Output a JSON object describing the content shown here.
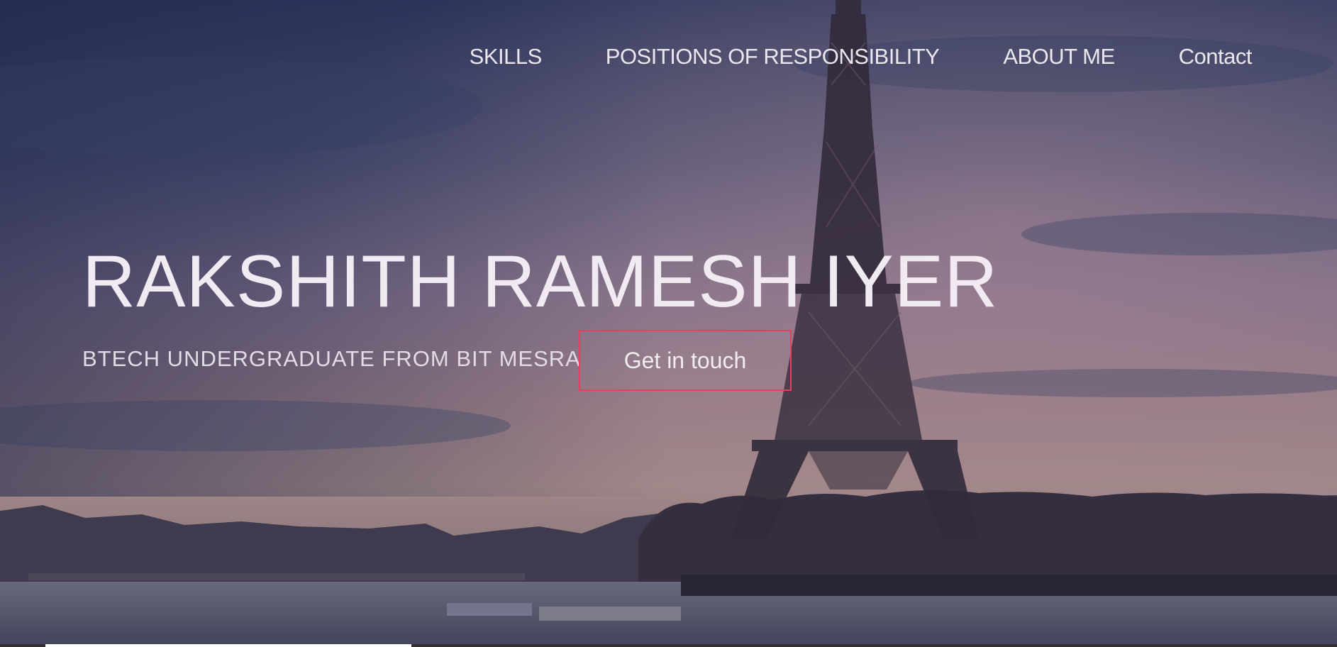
{
  "nav": {
    "items": [
      {
        "label": "SKILLS"
      },
      {
        "label": "POSITIONS OF RESPONSIBILITY"
      },
      {
        "label": "ABOUT ME"
      },
      {
        "label": "Contact"
      }
    ]
  },
  "hero": {
    "name": "RAKSHITH RAMESH IYER",
    "tagline": "BTECH UNDERGRADUATE FROM BIT MESRA",
    "cta_label": "Get in touch"
  },
  "colors": {
    "cta_border": "#e6405f",
    "text": "#f2eaf3",
    "sky_top": "#3d4a78",
    "sky_mid": "#a68aa3",
    "horizon": "#cfaea6"
  },
  "background": {
    "icon": "eiffel-tower-cityscape-image"
  }
}
